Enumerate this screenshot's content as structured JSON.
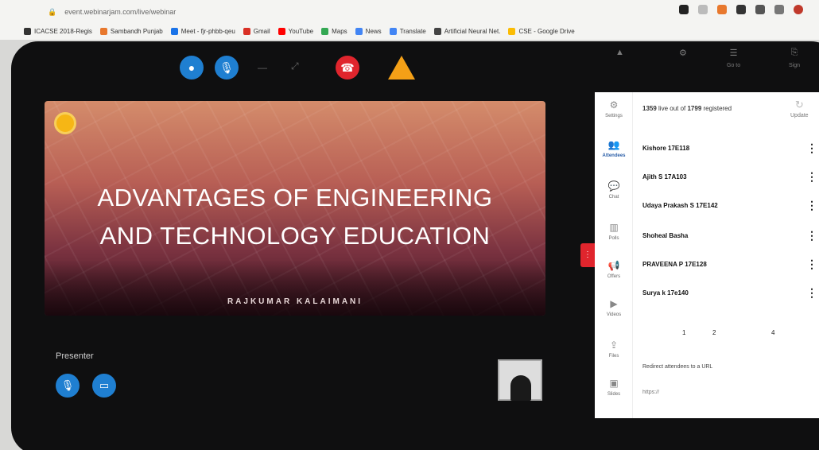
{
  "browser": {
    "url": "event.webinarjam.com/live/webinar",
    "bookmarks": [
      {
        "label": "ICACSE 2018-Regis",
        "color": "#333333"
      },
      {
        "label": "Sambandh Punjab",
        "color": "#e8782d"
      },
      {
        "label": "Meet - fjr-phbb-qeu",
        "color": "#1a73e8"
      },
      {
        "label": "Gmail",
        "color": "#d93025"
      },
      {
        "label": "YouTube",
        "color": "#ff0000"
      },
      {
        "label": "Maps",
        "color": "#34a853"
      },
      {
        "label": "News",
        "color": "#4285f4"
      },
      {
        "label": "Translate",
        "color": "#4285f4"
      },
      {
        "label": "Artificial Neural Net.",
        "color": "#444444"
      },
      {
        "label": "CSE - Google Drive",
        "color": "#fbbc04"
      }
    ]
  },
  "slide": {
    "title_line1": "ADVANTAGES OF ENGINEERING",
    "title_line2": "AND TECHNOLOGY EDUCATION",
    "author": "RAJKUMAR KALAIMANI"
  },
  "presenter": {
    "label": "Presenter"
  },
  "topbar_right": {
    "item3": "Go to",
    "item4": "Sign"
  },
  "panel": {
    "rail": [
      {
        "label": "Settings"
      },
      {
        "label": "Attendees"
      },
      {
        "label": "Chat"
      },
      {
        "label": "Polls"
      },
      {
        "label": "Offers"
      },
      {
        "label": "Videos"
      },
      {
        "label": "Files"
      },
      {
        "label": "Slides"
      }
    ],
    "count_live": "1359",
    "count_mid": " live out of ",
    "count_total": "1799",
    "count_suffix": " registered",
    "update_label": "Update",
    "attendees": [
      "Kishore 17E118",
      "Ajith S 17A103",
      "Udaya Prakash S 17E142",
      "Shoheal Basha",
      "PRAVEENA P 17E128",
      "Surya k 17e140"
    ],
    "pages": [
      "1",
      "2",
      "4"
    ],
    "redirect_label": "Redirect attendees to a URL",
    "redirect_placeholder": "https://"
  }
}
